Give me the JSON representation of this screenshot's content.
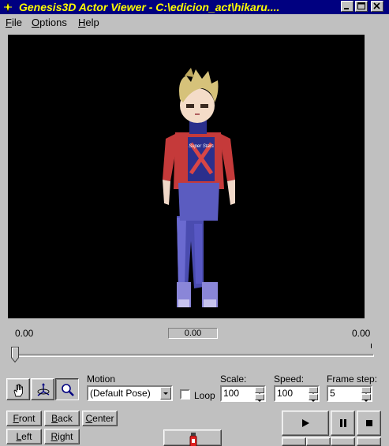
{
  "window": {
    "title": "Genesis3D Actor Viewer - C:\\edicion_act\\hikaru...."
  },
  "menubar": {
    "items": [
      {
        "key": "F",
        "rest": "ile"
      },
      {
        "key": "O",
        "rest": "ptions"
      },
      {
        "key": "H",
        "rest": "elp"
      }
    ]
  },
  "timeline": {
    "start": "0.00",
    "current": "0.00",
    "end": "0.00",
    "position": 0
  },
  "motion": {
    "label": "Motion",
    "selected": "(Default Pose)",
    "loop_label": "Loop",
    "loop_checked": false
  },
  "scale": {
    "label": "Scale:",
    "value": "100"
  },
  "speed": {
    "label": "Speed:",
    "value": "100"
  },
  "frame_step": {
    "label": "Frame step:",
    "value": "5"
  },
  "view_buttons": {
    "front": {
      "key": "F",
      "rest": "ront"
    },
    "back": {
      "key": "B",
      "rest": "ack"
    },
    "center": {
      "key": "C",
      "rest": "enter"
    },
    "left": {
      "key": "L",
      "rest": "eft"
    },
    "right": {
      "key": "R",
      "rest": "ight"
    }
  },
  "tools": [
    "hand-icon",
    "rotate-axes-icon",
    "zoom-icon"
  ],
  "colors": {
    "titlebar_bg": "#000080",
    "title_text": "#ffff00",
    "face": "#c0c0c0",
    "viewport": "#000000"
  }
}
